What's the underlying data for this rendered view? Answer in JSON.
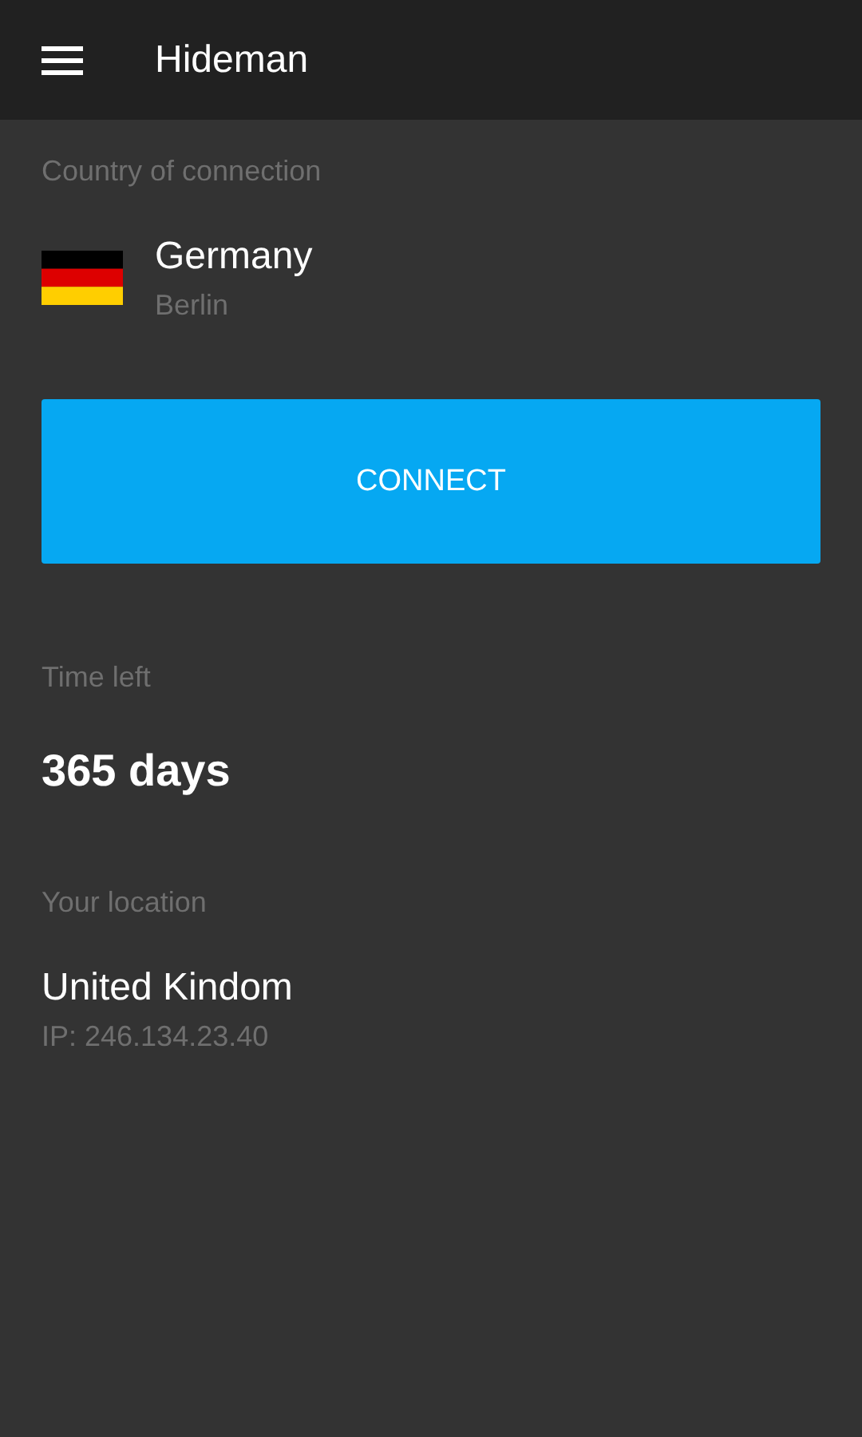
{
  "app_bar": {
    "title": "Hideman"
  },
  "connection": {
    "label": "Country of connection",
    "country": "Germany",
    "city": "Berlin"
  },
  "connect_button": {
    "label": "CONNECT"
  },
  "time_left": {
    "label": "Time left",
    "value": "365 days"
  },
  "location": {
    "label": "Your location",
    "country": "United Kindom",
    "ip": "IP: 246.134.23.40"
  }
}
